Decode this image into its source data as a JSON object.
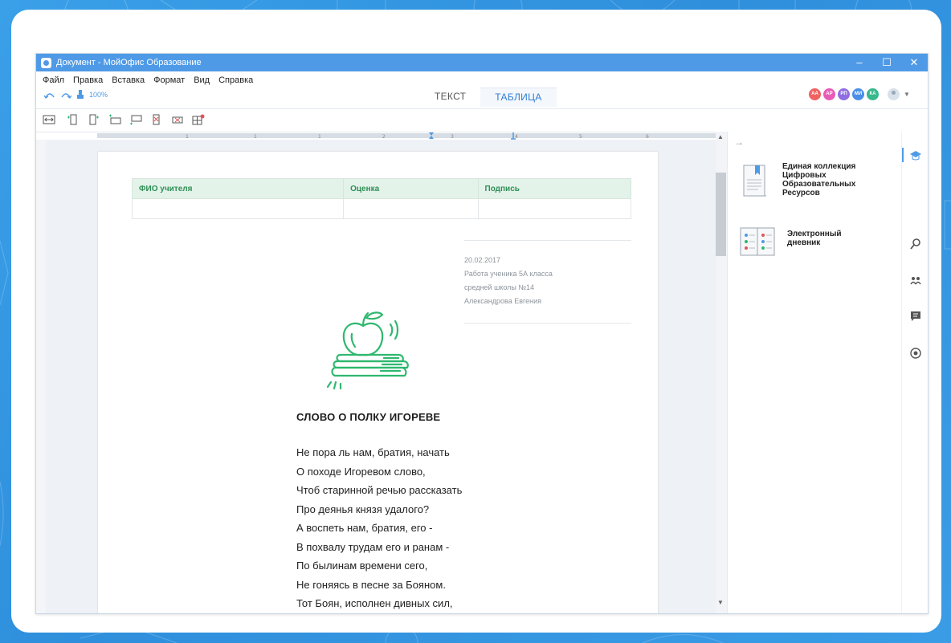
{
  "window": {
    "title": "Документ - МойОфис Образование"
  },
  "menu": [
    "Файл",
    "Правка",
    "Вставка",
    "Формат",
    "Вид",
    "Справка"
  ],
  "quick": {
    "zoom": "100%"
  },
  "tabs": [
    {
      "label": "ТЕКСТ",
      "active": false
    },
    {
      "label": "ТАБЛИЦА",
      "active": true
    }
  ],
  "avatars": [
    {
      "initials": "АА",
      "color": "#f06262"
    },
    {
      "initials": "АР",
      "color": "#e85ab7"
    },
    {
      "initials": "РП",
      "color": "#8f6fe0"
    },
    {
      "initials": "МИ",
      "color": "#4a8ee8"
    },
    {
      "initials": "КА",
      "color": "#36b78c"
    }
  ],
  "ruler": {
    "labels": [
      "1",
      "1",
      "1",
      "2",
      "3",
      "4",
      "5",
      "6"
    ]
  },
  "grade_table": {
    "headers": [
      "ФИО учителя",
      "Оценка",
      "Подпись"
    ]
  },
  "meta": {
    "date": "20.02.2017",
    "line1": "Работа ученика 5А класса",
    "line2": "средней школы №14",
    "line3": "Александрова Евгения"
  },
  "poem": {
    "title": "СЛОВО О ПОЛКУ ИГОРЕВЕ",
    "lines": [
      "Не пора ль нам, братия, начать",
      "О походе Игоревом слово,",
      "Чтоб старинной речью рассказать",
      "Про деянья князя удалого?",
      "А воспеть нам, братия, его -",
      "В похвалу трудам его и ранам -",
      "По былинам времени сего,",
      "Не гоняясь в песне за Бояном.",
      "Тот Боян, исполнен дивных сил,"
    ]
  },
  "panel": {
    "items": [
      {
        "label": "Единая коллекция Цифровых Образовательных Ресурсов"
      },
      {
        "label": "Электронный дневник"
      }
    ]
  },
  "colors": {
    "accent": "#4f9ae6",
    "green": "#2fb86f",
    "header_bg": "#e3f3ea"
  }
}
